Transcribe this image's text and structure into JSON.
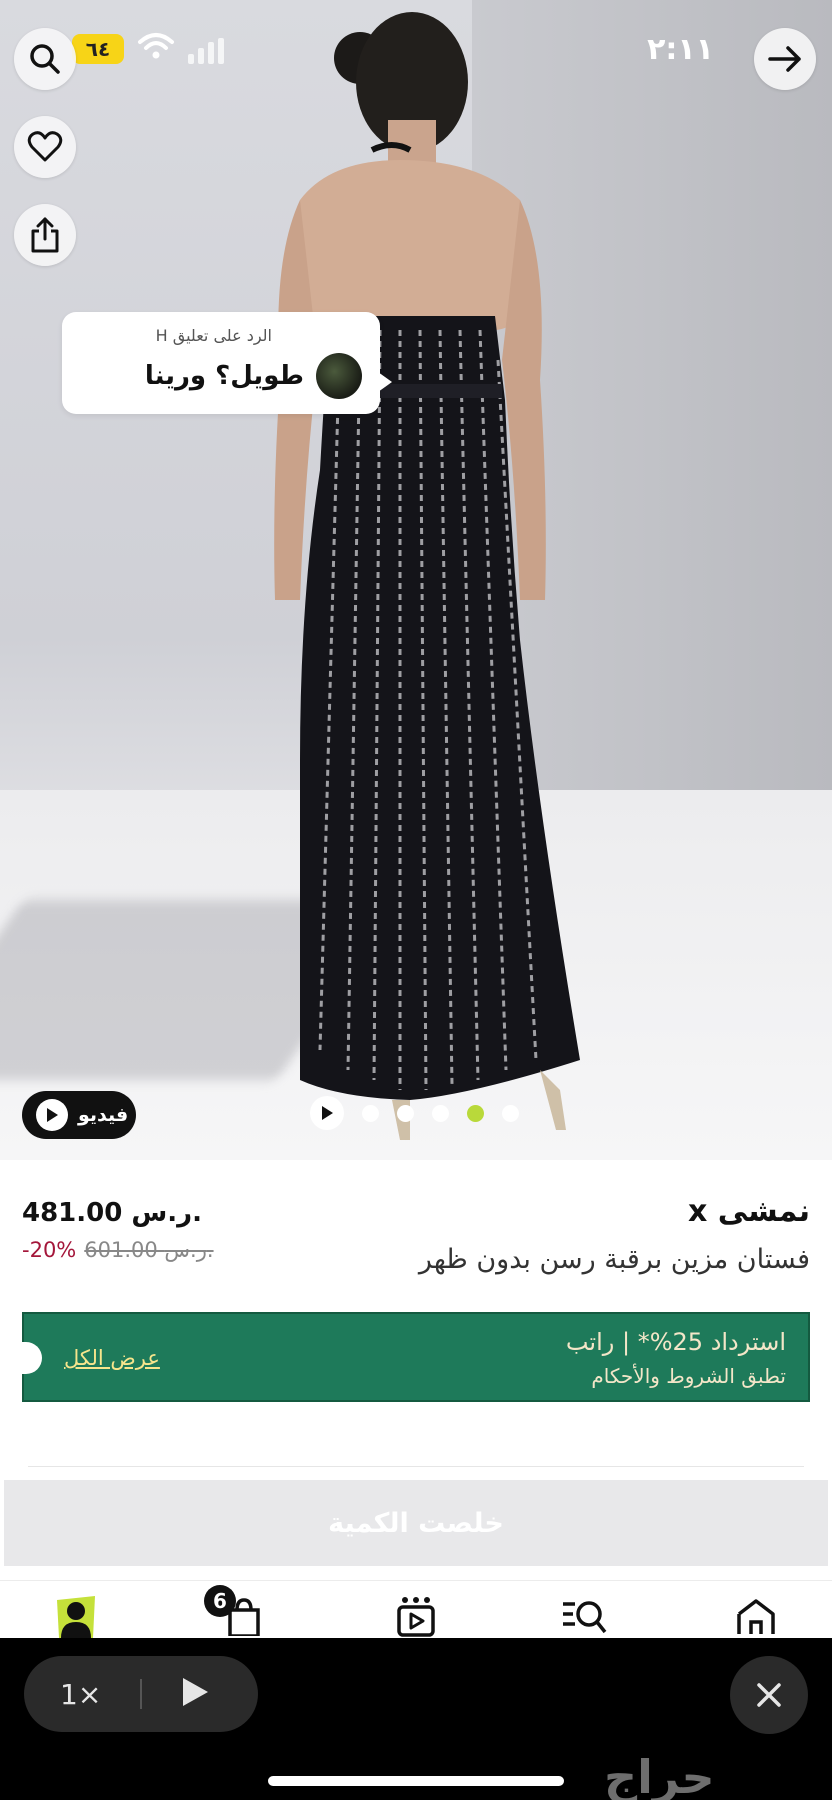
{
  "status_bar": {
    "time": "٢:١١",
    "battery": "٦٤"
  },
  "comment": {
    "reply_label": "الرد على تعليق H",
    "text": "طويل؟ ورينا"
  },
  "media": {
    "video_label": "فيديو",
    "dot_count": 5,
    "active_dot": 4
  },
  "product": {
    "brand": "نمشى x",
    "title": "فستان مزين برقبة رسن بدون ظهر",
    "price": "481.00 ر.س.",
    "old_price": "601.00 ر.س.",
    "discount": "-20%"
  },
  "rebate": {
    "line1": "استرداد 25%* | راتب",
    "line2": "تطبق الشروط والأحكام",
    "view_all": "عرض الكل",
    "bg_color": "#1e7a5a"
  },
  "buy_button": {
    "label": "خلصت الكمية"
  },
  "bottom_nav": {
    "cart_count": "6",
    "items": [
      "home-icon",
      "search-icon",
      "video-feed-icon",
      "cart-icon",
      "profile-icon"
    ]
  },
  "player": {
    "speed": "1×"
  },
  "watermark": "حراج"
}
